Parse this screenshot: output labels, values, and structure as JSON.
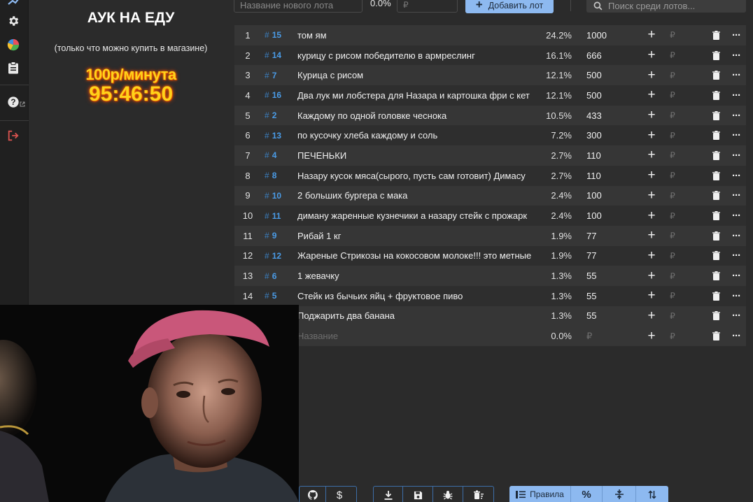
{
  "info": {
    "title": "АУК НА ЕДУ",
    "subtitle": "(только что можно купить в магазине)",
    "rate": "100р/минута",
    "timer": "95:46:50"
  },
  "toolbar": {
    "new_lot_placeholder": "Название нового лота",
    "percent": "0.0%",
    "rub_placeholder": "₽",
    "add_label": "Добавить лот",
    "search_placeholder": "Поиск среди лотов..."
  },
  "lots": [
    {
      "num": "1",
      "id": "15",
      "name": "том ям",
      "pct": "24.2%",
      "amount": "1000"
    },
    {
      "num": "2",
      "id": "14",
      "name": "курицу с рисом победителю в армреслинг",
      "pct": "16.1%",
      "amount": "666"
    },
    {
      "num": "3",
      "id": "7",
      "name": "Курица с рисом",
      "pct": "12.1%",
      "amount": "500"
    },
    {
      "num": "4",
      "id": "16",
      "name": "Два лук ми лобстера для Назара и картошка фри с кет",
      "pct": "12.1%",
      "amount": "500"
    },
    {
      "num": "5",
      "id": "2",
      "name": "Каждому по одной головке чеснока",
      "pct": "10.5%",
      "amount": "433"
    },
    {
      "num": "6",
      "id": "13",
      "name": "по кусочку хлеба каждому и соль",
      "pct": "7.2%",
      "amount": "300"
    },
    {
      "num": "7",
      "id": "4",
      "name": "ПЕЧЕНЬКИ",
      "pct": "2.7%",
      "amount": "110"
    },
    {
      "num": "8",
      "id": "8",
      "name": "Назару кусок мяса(сырого, пусть сам готовит) Димасу",
      "pct": "2.7%",
      "amount": "110"
    },
    {
      "num": "9",
      "id": "10",
      "name": "2 больших бургера с мака",
      "pct": "2.4%",
      "amount": "100"
    },
    {
      "num": "10",
      "id": "11",
      "name": "диману жаренные кузнечики а назару стейк с прожарк",
      "pct": "2.4%",
      "amount": "100"
    },
    {
      "num": "11",
      "id": "9",
      "name": "Рибай 1 кг",
      "pct": "1.9%",
      "amount": "77"
    },
    {
      "num": "12",
      "id": "12",
      "name": "Жареные Стрикозы на кокосовом молоке!!! это метные",
      "pct": "1.9%",
      "amount": "77"
    },
    {
      "num": "13",
      "id": "6",
      "name": "1 жевачку",
      "pct": "1.3%",
      "amount": "55"
    },
    {
      "num": "14",
      "id": "5",
      "name": "Стейк из бычьих яйц + фруктовое пиво",
      "pct": "1.3%",
      "amount": "55"
    },
    {
      "num": "",
      "id": "",
      "name": "Поджарить два банана",
      "pct": "1.3%",
      "amount": "55"
    }
  ],
  "new_row": {
    "name_placeholder": "Название",
    "pct": "0.0%",
    "amount_placeholder": "₽"
  },
  "row_rub_symbol": "₽",
  "bottom": {
    "rules_label": "Правила",
    "percent_symbol": "%"
  },
  "colors": {
    "accent": "#8db9f0",
    "id_blue": "#4a9be6",
    "timer_yellow": "#ffd21a",
    "logout_red": "#d9534f"
  }
}
